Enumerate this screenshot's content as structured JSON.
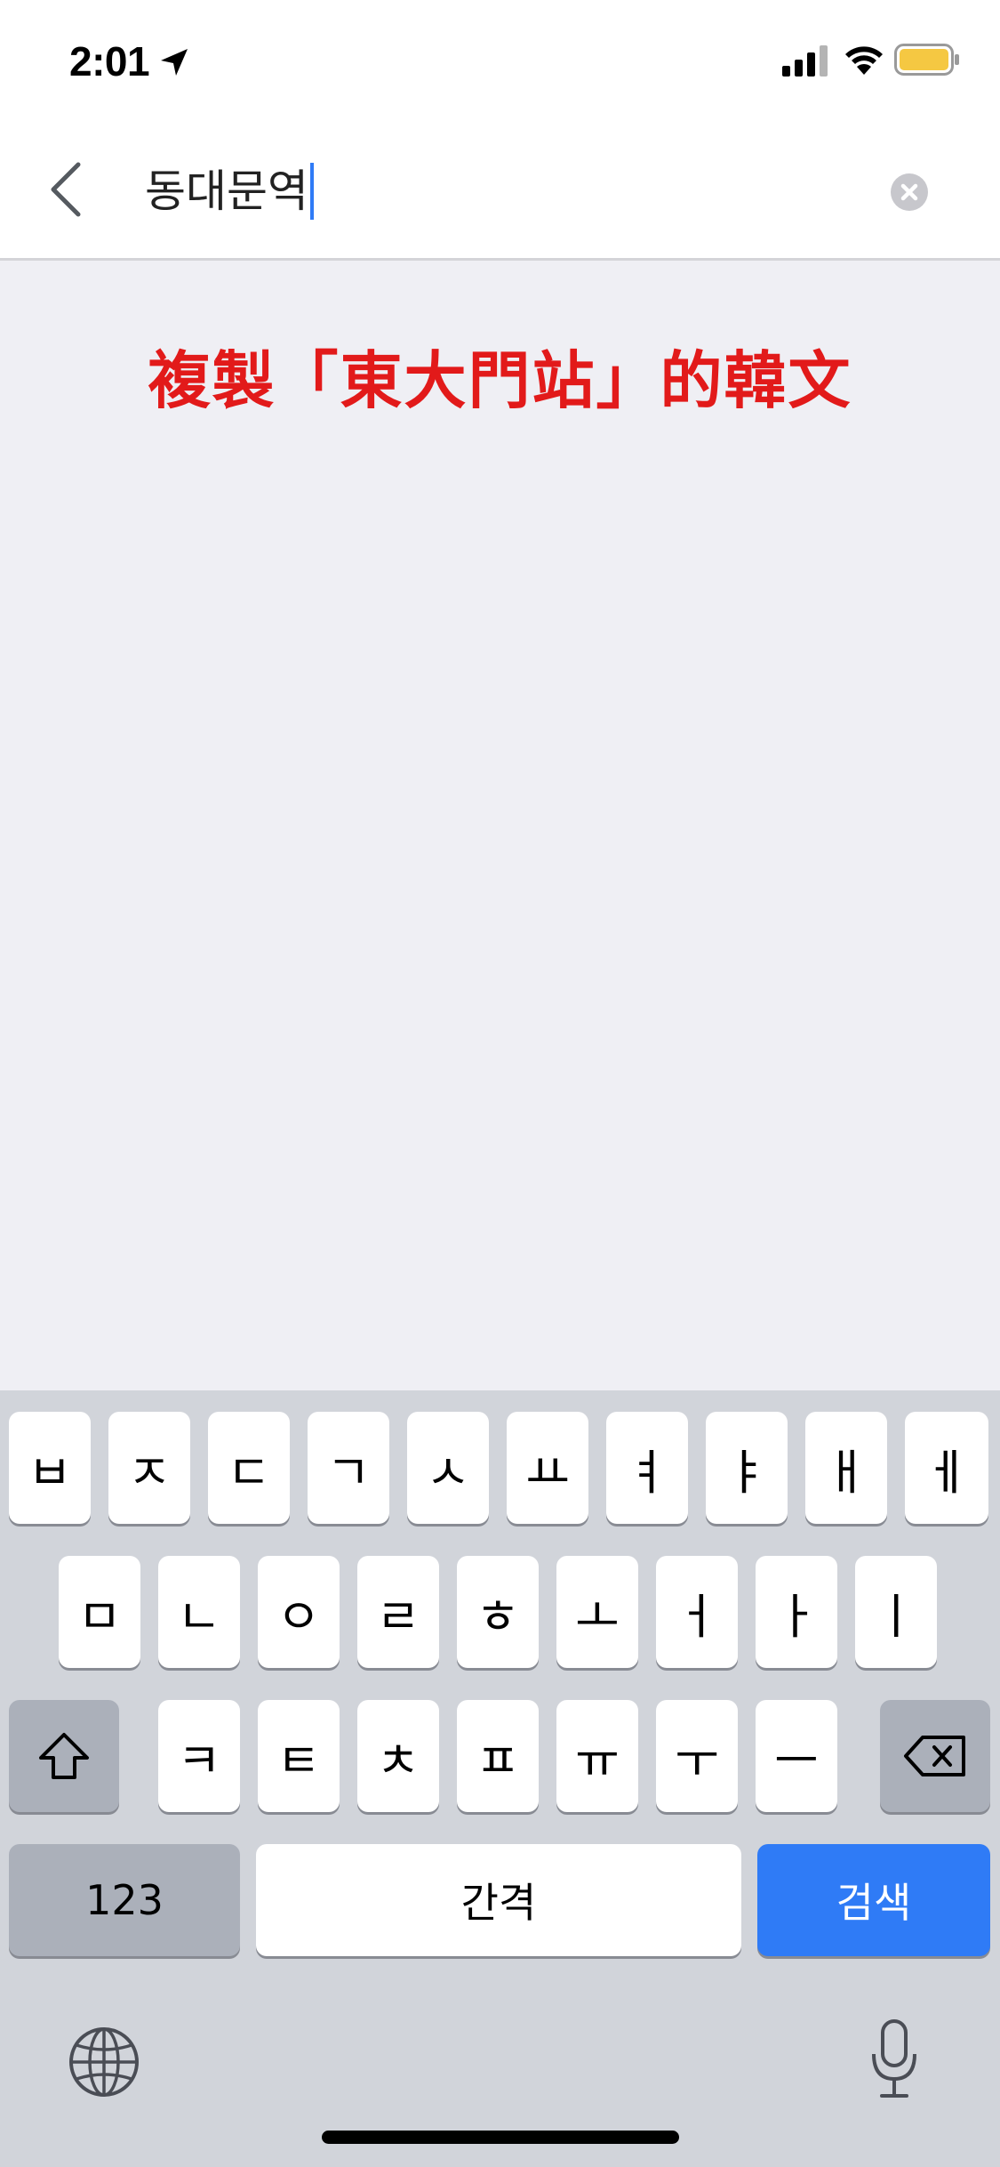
{
  "status_bar": {
    "time": "2:01"
  },
  "header": {
    "search_value": "동대문역"
  },
  "annotation": {
    "text": "複製「東大門站」的韓文"
  },
  "keyboard": {
    "row1": [
      "ㅂ",
      "ㅈ",
      "ㄷ",
      "ㄱ",
      "ㅅ",
      "ㅛ",
      "ㅕ",
      "ㅑ",
      "ㅐ",
      "ㅔ"
    ],
    "row2": [
      "ㅁ",
      "ㄴ",
      "ㅇ",
      "ㄹ",
      "ㅎ",
      "ㅗ",
      "ㅓ",
      "ㅏ",
      "ㅣ"
    ],
    "row3": [
      "ㅋ",
      "ㅌ",
      "ㅊ",
      "ㅍ",
      "ㅠ",
      "ㅜ",
      "ㅡ"
    ],
    "numbers_label": "123",
    "space_label": "간격",
    "search_label": "검색"
  },
  "colors": {
    "accent": "#2f7bf6",
    "annotation": "#e21a1a",
    "battery": "#f5c842"
  }
}
